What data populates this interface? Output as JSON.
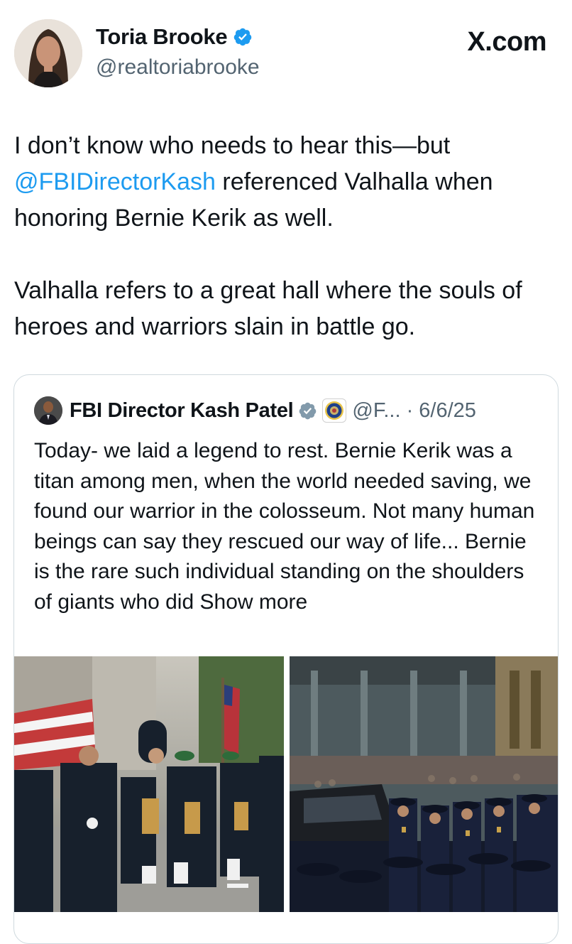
{
  "watermark": "X.com",
  "author": {
    "display_name": "Toria Brooke",
    "handle": "@realtoriabrooke",
    "verified": true
  },
  "tweet": {
    "line1": "I don’t know who needs to hear this—but",
    "mention": "@FBIDirectorKash",
    "line2_rest": " referenced Valhalla when honoring Bernie Kerik as well.",
    "paragraph2": "Valhalla refers to a great hall where the souls of heroes and warriors slain in battle go."
  },
  "quoted_tweet": {
    "display_name": "FBI Director Kash Patel",
    "handle_and_date": "@F... · 6/6/25",
    "verified": true,
    "affiliate_badge": "fbi-seal-icon",
    "text": "Today- we laid a legend to rest. Bernie Kerik was a titan among men, when the world needed saving, we found our warrior in the colosseum. Not many human beings can say they rescued our way of life... Bernie is the rare such individual standing on the shoulders of giants who did",
    "show_more": "Show more",
    "media": [
      "funeral-procession-photo",
      "police-officers-photo"
    ]
  },
  "colors": {
    "link": "#1d9bf0",
    "text": "#0f1419",
    "secondary": "#536471",
    "verified": "#1d9bf0",
    "border": "#cfd9de"
  }
}
